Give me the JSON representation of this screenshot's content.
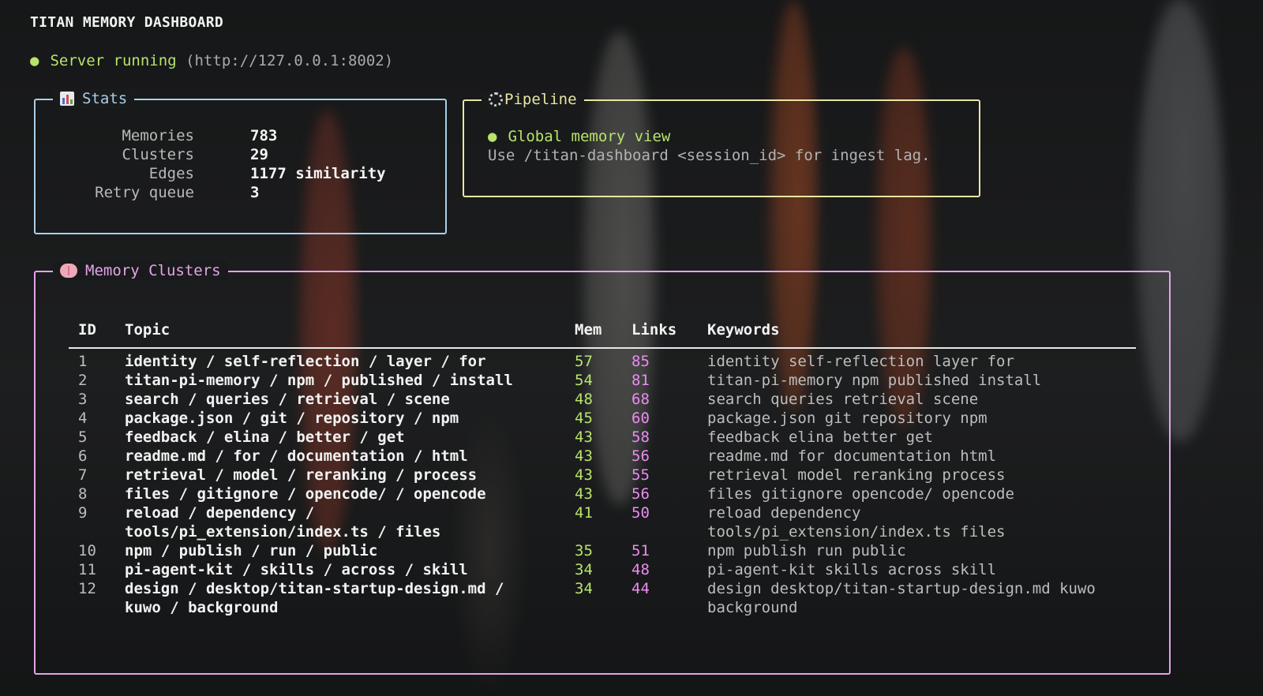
{
  "header": {
    "title": "TITAN MEMORY DASHBOARD"
  },
  "server": {
    "status_label": "Server running",
    "url": "(http://127.0.0.1:8002)",
    "status_color": "#b7e36b"
  },
  "stats": {
    "title": "Stats",
    "icon": "bar-chart-icon",
    "rows": [
      {
        "label": "Memories",
        "value": "783"
      },
      {
        "label": "Clusters",
        "value": "29"
      },
      {
        "label": "Edges",
        "value": "1177 similarity"
      },
      {
        "label": "Retry queue",
        "value": "3"
      }
    ]
  },
  "pipeline": {
    "title": "Pipeline",
    "icon": "gear-icon",
    "status": "Global memory view",
    "hint": "Use /titan-dashboard <session_id> for ingest lag."
  },
  "clusters": {
    "title": "Memory Clusters",
    "icon": "brain-icon",
    "headers": {
      "id": "ID",
      "topic": "Topic",
      "mem": "Mem",
      "links": "Links",
      "keywords": "Keywords"
    },
    "rows": [
      {
        "id": "1",
        "topic": [
          "identity / self-reflection / layer / for"
        ],
        "mem": "57",
        "links": "85",
        "keywords": [
          "identity self-reflection layer for"
        ]
      },
      {
        "id": "2",
        "topic": [
          "titan-pi-memory / npm / published / install"
        ],
        "mem": "54",
        "links": "81",
        "keywords": [
          "titan-pi-memory npm published install"
        ]
      },
      {
        "id": "3",
        "topic": [
          "search / queries / retrieval / scene"
        ],
        "mem": "48",
        "links": "68",
        "keywords": [
          "search queries retrieval scene"
        ]
      },
      {
        "id": "4",
        "topic": [
          "package.json / git / repository / npm"
        ],
        "mem": "45",
        "links": "60",
        "keywords": [
          "package.json git repository npm"
        ]
      },
      {
        "id": "5",
        "topic": [
          "feedback / elina / better / get"
        ],
        "mem": "43",
        "links": "58",
        "keywords": [
          "feedback elina better get"
        ]
      },
      {
        "id": "6",
        "topic": [
          "readme.md / for / documentation / html"
        ],
        "mem": "43",
        "links": "56",
        "keywords": [
          "readme.md for documentation html"
        ]
      },
      {
        "id": "7",
        "topic": [
          "retrieval / model / reranking / process"
        ],
        "mem": "43",
        "links": "55",
        "keywords": [
          "retrieval model reranking process"
        ]
      },
      {
        "id": "8",
        "topic": [
          "files / gitignore / opencode/ / opencode"
        ],
        "mem": "43",
        "links": "56",
        "keywords": [
          "files gitignore opencode/ opencode"
        ]
      },
      {
        "id": "9",
        "topic": [
          "reload / dependency /",
          "tools/pi_extension/index.ts / files"
        ],
        "mem": "41",
        "links": "50",
        "keywords": [
          "reload dependency",
          "tools/pi_extension/index.ts files"
        ]
      },
      {
        "id": "10",
        "topic": [
          "npm / publish / run / public"
        ],
        "mem": "35",
        "links": "51",
        "keywords": [
          "npm publish run public"
        ]
      },
      {
        "id": "11",
        "topic": [
          "pi-agent-kit / skills / across / skill"
        ],
        "mem": "34",
        "links": "48",
        "keywords": [
          "pi-agent-kit skills across skill"
        ]
      },
      {
        "id": "12",
        "topic": [
          "design / desktop/titan-startup-design.md /",
          "kuwo / background"
        ],
        "mem": "34",
        "links": "44",
        "keywords": [
          "design desktop/titan-startup-design.md kuwo",
          "background"
        ]
      }
    ]
  }
}
